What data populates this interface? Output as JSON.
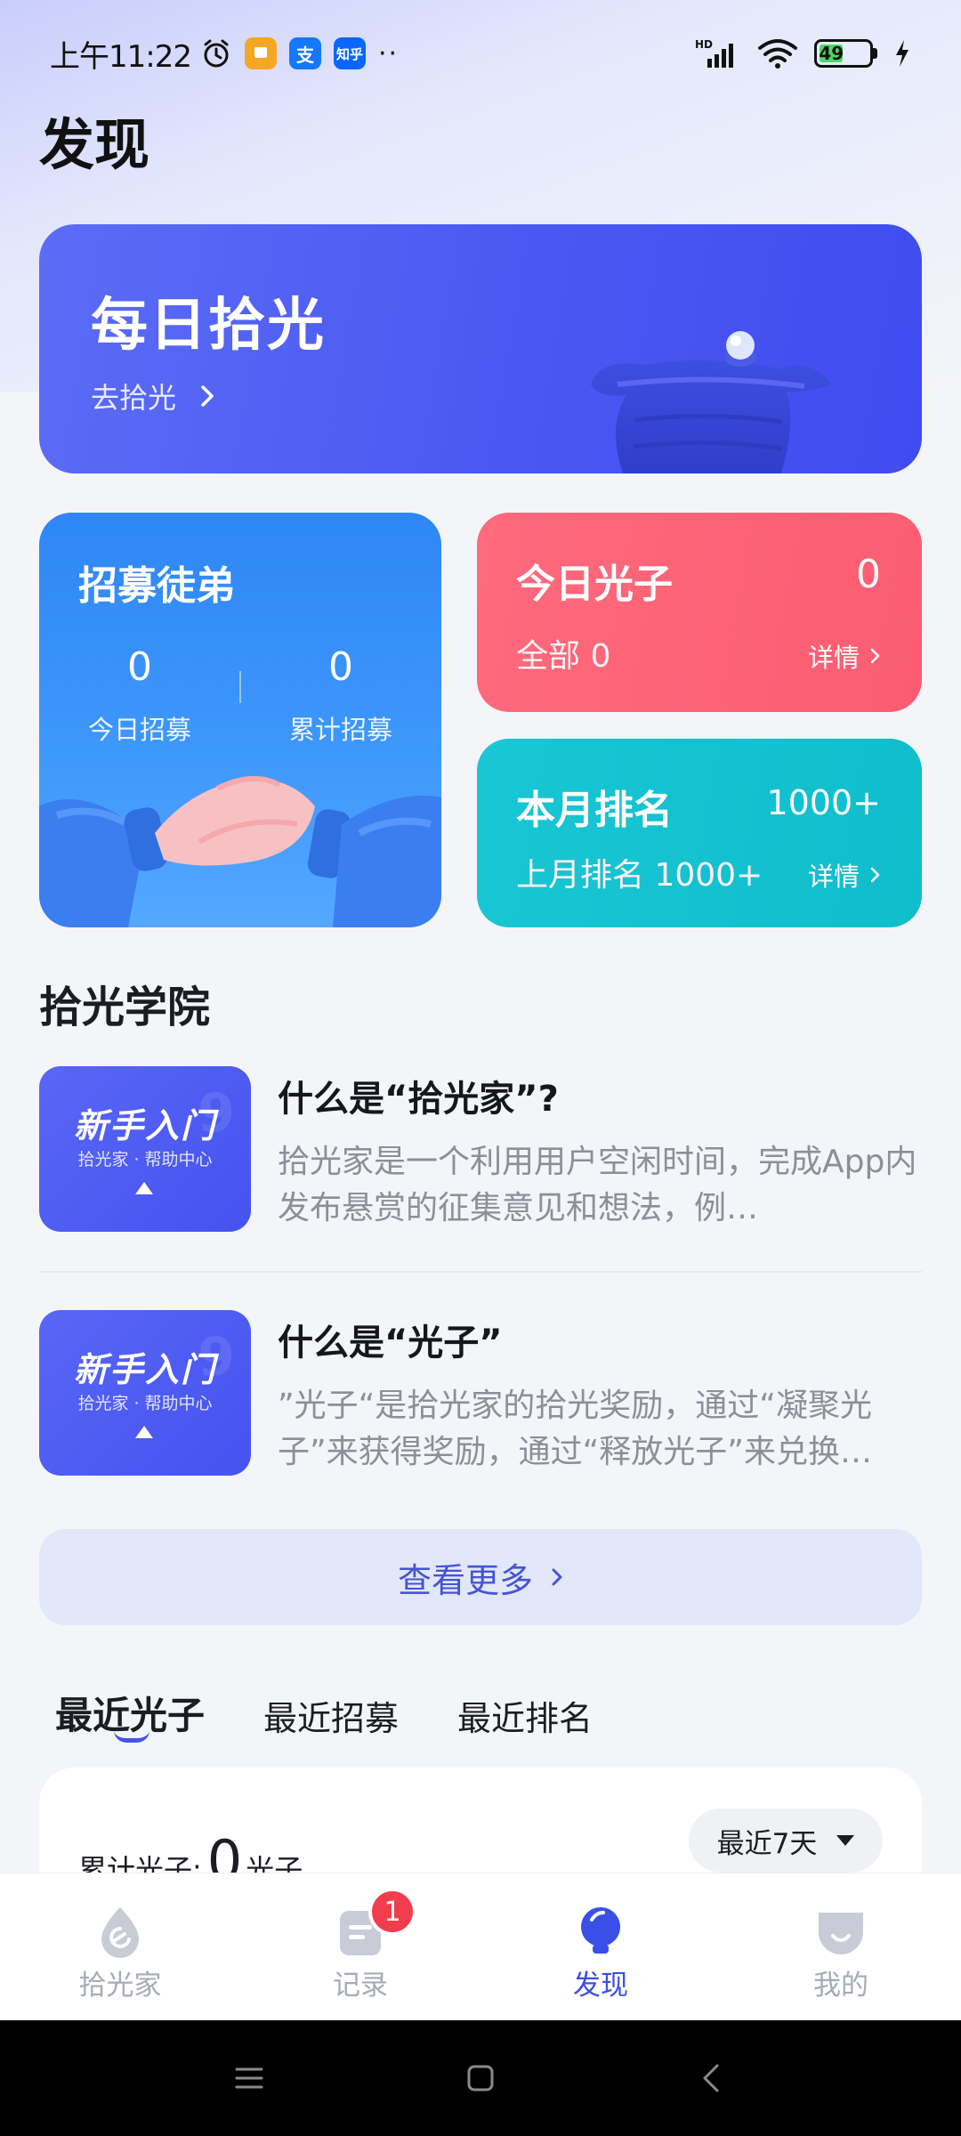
{
  "status_bar": {
    "time": "上午11:22",
    "battery": "49",
    "app_icons": [
      "alarm-icon",
      "note-app-icon",
      "alipay-icon",
      "zhihu-icon"
    ],
    "zhihu_label": "知乎",
    "alipay_label": "支",
    "network_label": "HD"
  },
  "page": {
    "title": "发现"
  },
  "banner": {
    "title": "每日拾光",
    "link": "去拾光"
  },
  "recruit": {
    "title": "招募徒弟",
    "today_value": "0",
    "today_label": "今日招募",
    "total_value": "0",
    "total_label": "累计招募"
  },
  "photon_today": {
    "title": "今日光子",
    "value": "0",
    "sub": "全部 0",
    "detail": "详情"
  },
  "monthly_rank": {
    "title": "本月排名",
    "value": "1000+",
    "sub": "上月排名 1000+",
    "detail": "详情"
  },
  "academy": {
    "title": "拾光学院",
    "thumb_title": "新手入门",
    "thumb_sub": "拾光家 · 帮助中心",
    "articles": [
      {
        "title": "什么是“拾光家”?",
        "desc": "拾光家是一个利用用户空闲时间，完成App内发布悬赏的征集意见和想法，例…"
      },
      {
        "title": "什么是“光子”",
        "desc": "”光子“是拾光家的拾光奖励，通过“凝聚光子”来获得奖励，通过“释放光子”来兑换…"
      }
    ],
    "more": "查看更多"
  },
  "tabs": [
    "最近光子",
    "最近招募",
    "最近排名"
  ],
  "summary": {
    "label": "累计光子:",
    "value": "0",
    "unit": "光子",
    "range": "最近7天"
  },
  "bottom_nav": [
    {
      "label": "拾光家",
      "icon": "home-drop-icon"
    },
    {
      "label": "记录",
      "icon": "record-icon",
      "badge": "1"
    },
    {
      "label": "发现",
      "icon": "bulb-icon"
    },
    {
      "label": "我的",
      "icon": "profile-icon"
    }
  ],
  "colors": {
    "accent": "#3a4ee8",
    "banner": "#4a58f2",
    "recruit": "#3f98fb",
    "photon": "#fb5c72",
    "rank": "#0fbdcc"
  }
}
